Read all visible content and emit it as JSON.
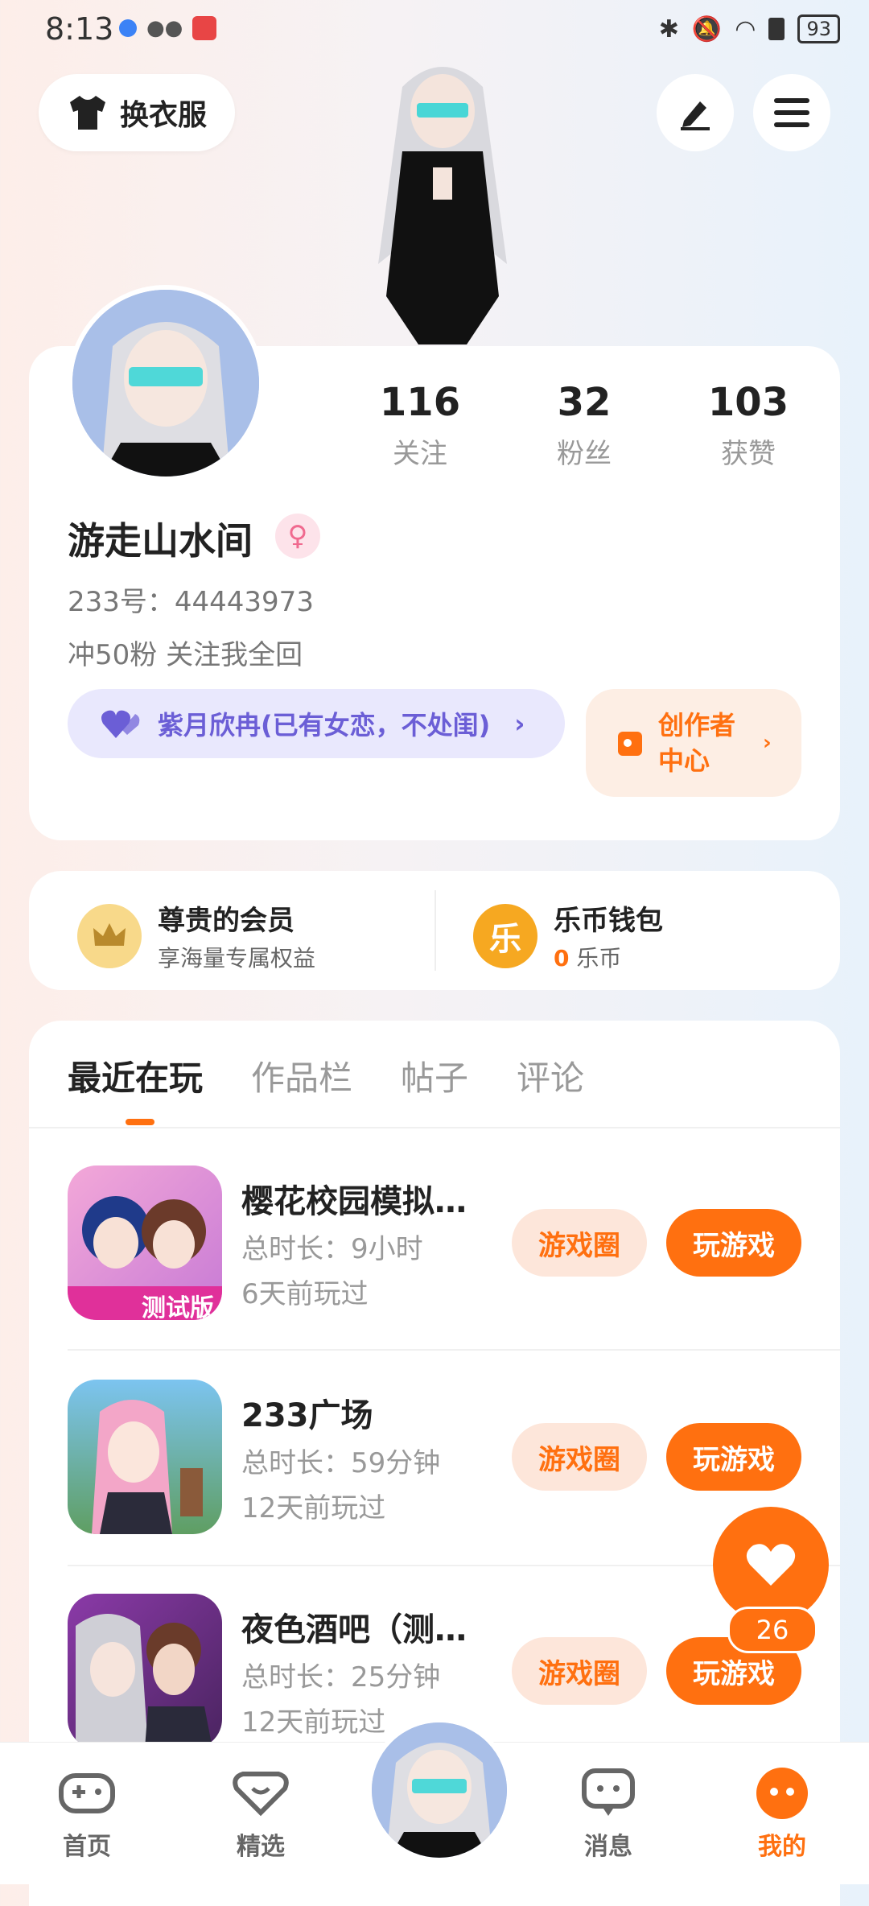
{
  "status_bar": {
    "time": "8:13",
    "battery": "93"
  },
  "header": {
    "wardrobe_label": "换衣服"
  },
  "profile": {
    "stats": [
      {
        "value": "116",
        "label": "关注"
      },
      {
        "value": "32",
        "label": "粉丝"
      },
      {
        "value": "103",
        "label": "获赞"
      }
    ],
    "nickname": "游走山水间",
    "gender_icon": "female-icon",
    "id_line": "233号：44443973",
    "bio": "冲50粉  关注我全回",
    "family_label": "紫月欣冉(已有女恋，不处闺)",
    "creator_label_line1": "创作者",
    "creator_label_line2": "中心"
  },
  "membership": {
    "title": "尊贵的会员",
    "subtitle": "享海量专属权益"
  },
  "wallet": {
    "title": "乐币钱包",
    "amount": "0",
    "unit": "乐币",
    "coin_glyph": "乐"
  },
  "tabs": [
    "最近在玩",
    "作品栏",
    "帖子",
    "评论"
  ],
  "games": [
    {
      "title": "樱花校园模拟…",
      "duration": "总时长：9小时",
      "last_played": "6天前玩过",
      "icon_badge": "测试版"
    },
    {
      "title": "233广场",
      "duration": "总时长：59分钟",
      "last_played": "12天前玩过"
    },
    {
      "title": "夜色酒吧（测…",
      "duration": "总时长：25分钟",
      "last_played": "12天前玩过"
    }
  ],
  "game_buttons": {
    "circle": "游戏圈",
    "play": "玩游戏"
  },
  "float_like": {
    "count": "26"
  },
  "bottom_nav": [
    {
      "label": "首页",
      "icon": "gamepad-icon"
    },
    {
      "label": "精选",
      "icon": "heart-box-icon"
    },
    {
      "label": "消息",
      "icon": "chat-bubble-icon"
    },
    {
      "label": "我的",
      "icon": "profile-dots-icon"
    }
  ],
  "colors": {
    "accent": "#ff7010",
    "family": "#6b5ed6",
    "coin": "#f6a821"
  }
}
